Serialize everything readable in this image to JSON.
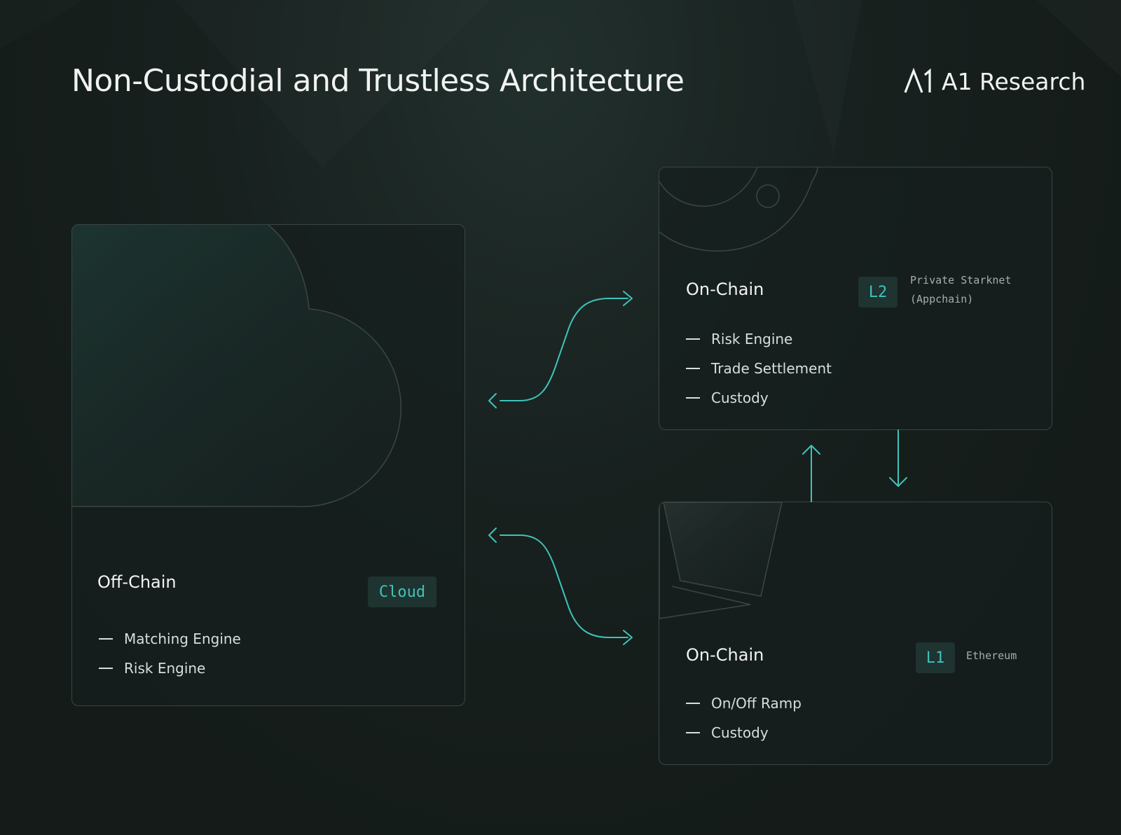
{
  "title": "Non-Custodial and Trustless Architecture",
  "brand": {
    "logo": "a1-logo-mark",
    "name": "A1 Research"
  },
  "colors": {
    "accent": "#3fc3ba",
    "background": "#161e1c",
    "card_border": "#3a4542"
  },
  "off_chain": {
    "title": "Off-Chain",
    "tag": "Cloud",
    "items": [
      "Matching Engine",
      "Risk Engine"
    ]
  },
  "l2": {
    "title": "On-Chain",
    "tag": "L2",
    "note_lines": [
      "Private Starknet",
      "(Appchain)"
    ],
    "items": [
      "Risk Engine",
      "Trade Settlement",
      "Custody"
    ]
  },
  "l1": {
    "title": "On-Chain",
    "tag": "L1",
    "note": "Ethereum",
    "items": [
      "On/Off Ramp",
      "Custody"
    ]
  }
}
